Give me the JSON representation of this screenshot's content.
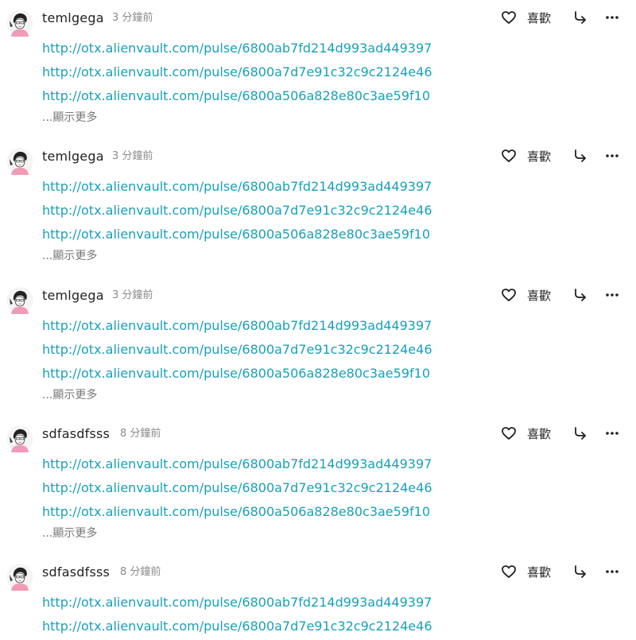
{
  "feed": {
    "like_label": "喜歡",
    "show_more_label": "...顯示更多",
    "colors": {
      "link": "#1aa0b8",
      "username": "#222222",
      "timestamp": "#8a8a8a",
      "show_more": "#777777"
    },
    "icons": {
      "like": "heart-outline-icon",
      "share": "share-arrow-icon",
      "more": "more-dots-icon",
      "avatar": "cartoon-person-avatar"
    },
    "posts": [
      {
        "username": "temlgega",
        "time": "3 分鐘前",
        "links": [
          "http://otx.alienvault.com/pulse/6800ab7fd214d993ad449397",
          "http://otx.alienvault.com/pulse/6800a7d7e91c32c9c2124e46",
          "http://otx.alienvault.com/pulse/6800a506a828e80c3ae59f10"
        ]
      },
      {
        "username": "temlgega",
        "time": "3 分鐘前",
        "links": [
          "http://otx.alienvault.com/pulse/6800ab7fd214d993ad449397",
          "http://otx.alienvault.com/pulse/6800a7d7e91c32c9c2124e46",
          "http://otx.alienvault.com/pulse/6800a506a828e80c3ae59f10"
        ]
      },
      {
        "username": "temlgega",
        "time": "3 分鐘前",
        "links": [
          "http://otx.alienvault.com/pulse/6800ab7fd214d993ad449397",
          "http://otx.alienvault.com/pulse/6800a7d7e91c32c9c2124e46",
          "http://otx.alienvault.com/pulse/6800a506a828e80c3ae59f10"
        ]
      },
      {
        "username": "sdfasdfsss",
        "time": "8 分鐘前",
        "links": [
          "http://otx.alienvault.com/pulse/6800ab7fd214d993ad449397",
          "http://otx.alienvault.com/pulse/6800a7d7e91c32c9c2124e46",
          "http://otx.alienvault.com/pulse/6800a506a828e80c3ae59f10"
        ]
      },
      {
        "username": "sdfasdfsss",
        "time": "8 分鐘前",
        "links": [
          "http://otx.alienvault.com/pulse/6800ab7fd214d993ad449397",
          "http://otx.alienvault.com/pulse/6800a7d7e91c32c9c2124e46"
        ]
      }
    ]
  }
}
